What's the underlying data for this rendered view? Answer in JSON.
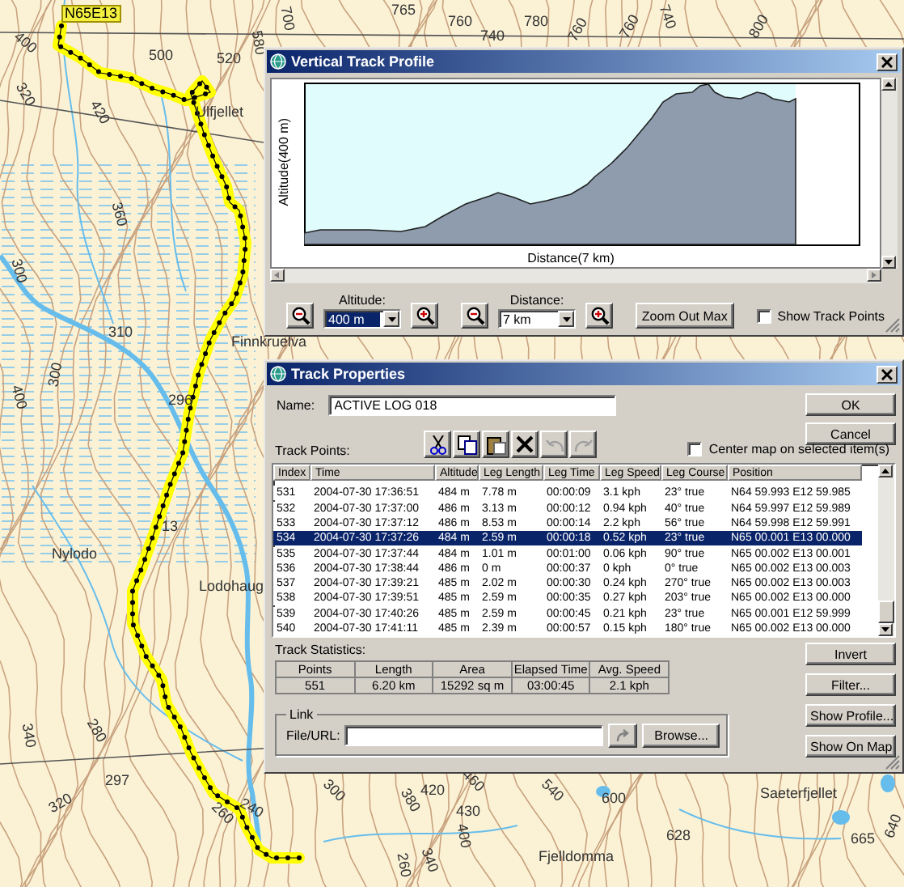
{
  "map": {
    "labels": [
      {
        "kind": "badge",
        "text": "N65E13"
      },
      {
        "kind": "place",
        "text": "Ulfjellet"
      },
      {
        "kind": "place",
        "text": "Finnkruelva"
      },
      {
        "kind": "place",
        "text": "Nylodo"
      },
      {
        "kind": "place",
        "text": "Lodohaug"
      },
      {
        "kind": "place",
        "text": "Saeterfjellet"
      },
      {
        "kind": "place",
        "text": "Fjelldomma"
      },
      {
        "kind": "elevation",
        "text": "400"
      },
      {
        "kind": "elevation",
        "text": "320"
      },
      {
        "kind": "elevation",
        "text": "420"
      },
      {
        "kind": "elevation",
        "text": "500"
      },
      {
        "kind": "elevation",
        "text": "520"
      },
      {
        "kind": "elevation",
        "text": "580"
      },
      {
        "kind": "elevation",
        "text": "360"
      },
      {
        "kind": "elevation",
        "text": "300"
      },
      {
        "kind": "elevation",
        "text": "310"
      },
      {
        "kind": "elevation",
        "text": "300"
      },
      {
        "kind": "elevation",
        "text": "296"
      },
      {
        "kind": "elevation",
        "text": "400"
      },
      {
        "kind": "elevation",
        "text": "13"
      },
      {
        "kind": "elevation",
        "text": "280"
      },
      {
        "kind": "elevation",
        "text": "340"
      },
      {
        "kind": "elevation",
        "text": "297"
      },
      {
        "kind": "elevation",
        "text": "320"
      },
      {
        "kind": "elevation",
        "text": "260"
      },
      {
        "kind": "elevation",
        "text": "240"
      },
      {
        "kind": "elevation",
        "text": "700"
      },
      {
        "kind": "elevation",
        "text": "765"
      },
      {
        "kind": "elevation",
        "text": "760"
      },
      {
        "kind": "elevation",
        "text": "780"
      },
      {
        "kind": "elevation",
        "text": "740"
      },
      {
        "kind": "elevation",
        "text": "760"
      },
      {
        "kind": "elevation",
        "text": "760"
      },
      {
        "kind": "elevation",
        "text": "740"
      },
      {
        "kind": "elevation",
        "text": "800"
      },
      {
        "kind": "elevation",
        "text": "420"
      },
      {
        "kind": "elevation",
        "text": "460"
      },
      {
        "kind": "elevation",
        "text": "540"
      },
      {
        "kind": "elevation",
        "text": "600"
      },
      {
        "kind": "elevation",
        "text": "380"
      },
      {
        "kind": "elevation",
        "text": "430"
      },
      {
        "kind": "elevation",
        "text": "400"
      },
      {
        "kind": "elevation",
        "text": "628"
      },
      {
        "kind": "elevation",
        "text": "665"
      },
      {
        "kind": "elevation",
        "text": "640"
      },
      {
        "kind": "elevation",
        "text": "340"
      },
      {
        "kind": "elevation",
        "text": "260"
      },
      {
        "kind": "elevation",
        "text": "300"
      }
    ]
  },
  "profile_window": {
    "title": "Vertical Track Profile",
    "y_axis_label": "Altitude(400 m)",
    "x_axis_label": "Distance(7 km)",
    "altitude": {
      "label": "Altitude:",
      "value": "400 m",
      "focused": true
    },
    "distance": {
      "label": "Distance:",
      "value": "7 km",
      "focused": false
    },
    "zoom_out_max_button": "Zoom Out Max",
    "show_track_points": {
      "label": "Show Track Points",
      "checked": false
    }
  },
  "track_window": {
    "title": "Track Properties",
    "name": {
      "label": "Name:",
      "value": "ACTIVE LOG 018"
    },
    "buttons": [
      "OK",
      "Cancel"
    ],
    "toolbar": [
      {
        "kind": "cut",
        "disabled": false
      },
      {
        "kind": "copy",
        "disabled": false
      },
      {
        "kind": "paste",
        "disabled": false
      },
      {
        "kind": "delete",
        "disabled": false
      },
      {
        "kind": "undo",
        "disabled": true
      },
      {
        "kind": "redo",
        "disabled": true
      }
    ],
    "track_points_label": "Track Points:",
    "center_map": {
      "label": "Center map on selected item(s)",
      "checked": false
    },
    "table": {
      "columns": [
        "Index",
        "Time",
        "Altitude",
        "Leg Length",
        "Leg Time",
        "Leg Speed",
        "Leg Course",
        "Position"
      ],
      "rows": [
        {
          "cells": [
            "531",
            "2004-07-30 17:36:51",
            "484 m",
            "7.78 m",
            "00:00:09",
            "3.1 kph",
            "23° true",
            "N64 59.993 E12 59.985"
          ],
          "selected": false
        },
        {
          "cells": [
            "532",
            "2004-07-30 17:37:00",
            "486 m",
            "3.13 m",
            "00:00:12",
            "0.94 kph",
            "40° true",
            "N64 59.997 E12 59.989"
          ],
          "selected": false
        },
        {
          "cells": [
            "533",
            "2004-07-30 17:37:12",
            "486 m",
            "8.53 m",
            "00:00:14",
            "2.2 kph",
            "56° true",
            "N64 59.998 E12 59.991"
          ],
          "selected": false
        },
        {
          "cells": [
            "534",
            "2004-07-30 17:37:26",
            "484 m",
            "2.59 m",
            "00:00:18",
            "0.52 kph",
            "23° true",
            "N65 00.001 E13 00.000"
          ],
          "selected": true
        },
        {
          "cells": [
            "535",
            "2004-07-30 17:37:44",
            "484 m",
            "1.01 m",
            "00:01:00",
            "0.06 kph",
            "90° true",
            "N65 00.002 E13 00.001"
          ],
          "selected": false
        },
        {
          "cells": [
            "536",
            "2004-07-30 17:38:44",
            "486 m",
            "0 m",
            "00:00:37",
            "0 kph",
            "0° true",
            "N65 00.002 E13 00.003"
          ],
          "selected": false
        },
        {
          "cells": [
            "537",
            "2004-07-30 17:39:21",
            "485 m",
            "2.02 m",
            "00:00:30",
            "0.24 kph",
            "270° true",
            "N65 00.002 E13 00.003"
          ],
          "selected": false
        },
        {
          "cells": [
            "538",
            "2004-07-30 17:39:51",
            "485 m",
            "2.59 m",
            "00:00:35",
            "0.27 kph",
            "203° true",
            "N65 00.002 E13 00.000"
          ],
          "selected": false
        },
        {
          "cells": [
            "539",
            "2004-07-30 17:40:26",
            "485 m",
            "2.59 m",
            "00:00:45",
            "0.21 kph",
            "23° true",
            "N65 00.001 E12 59.999"
          ],
          "selected": false
        },
        {
          "cells": [
            "540",
            "2004-07-30 17:41:11",
            "485 m",
            "2.39 m",
            "00:00:57",
            "0.15 kph",
            "180° true",
            "N65 00.002 E13 00.000"
          ],
          "selected": false
        }
      ]
    },
    "statistics": {
      "label": "Track Statistics:",
      "columns": [
        "Points",
        "Length",
        "Area",
        "Elapsed Time",
        "Avg. Speed"
      ],
      "values": [
        "551",
        "6.20 km",
        "15292 sq m",
        "03:00:45",
        "2.1 kph"
      ]
    },
    "side_buttons": [
      "Invert",
      "Filter...",
      "Show Profile...",
      "Show On Map"
    ],
    "link": {
      "label": "Link",
      "field_label": "File/URL:",
      "browse_button": "Browse..."
    }
  }
}
